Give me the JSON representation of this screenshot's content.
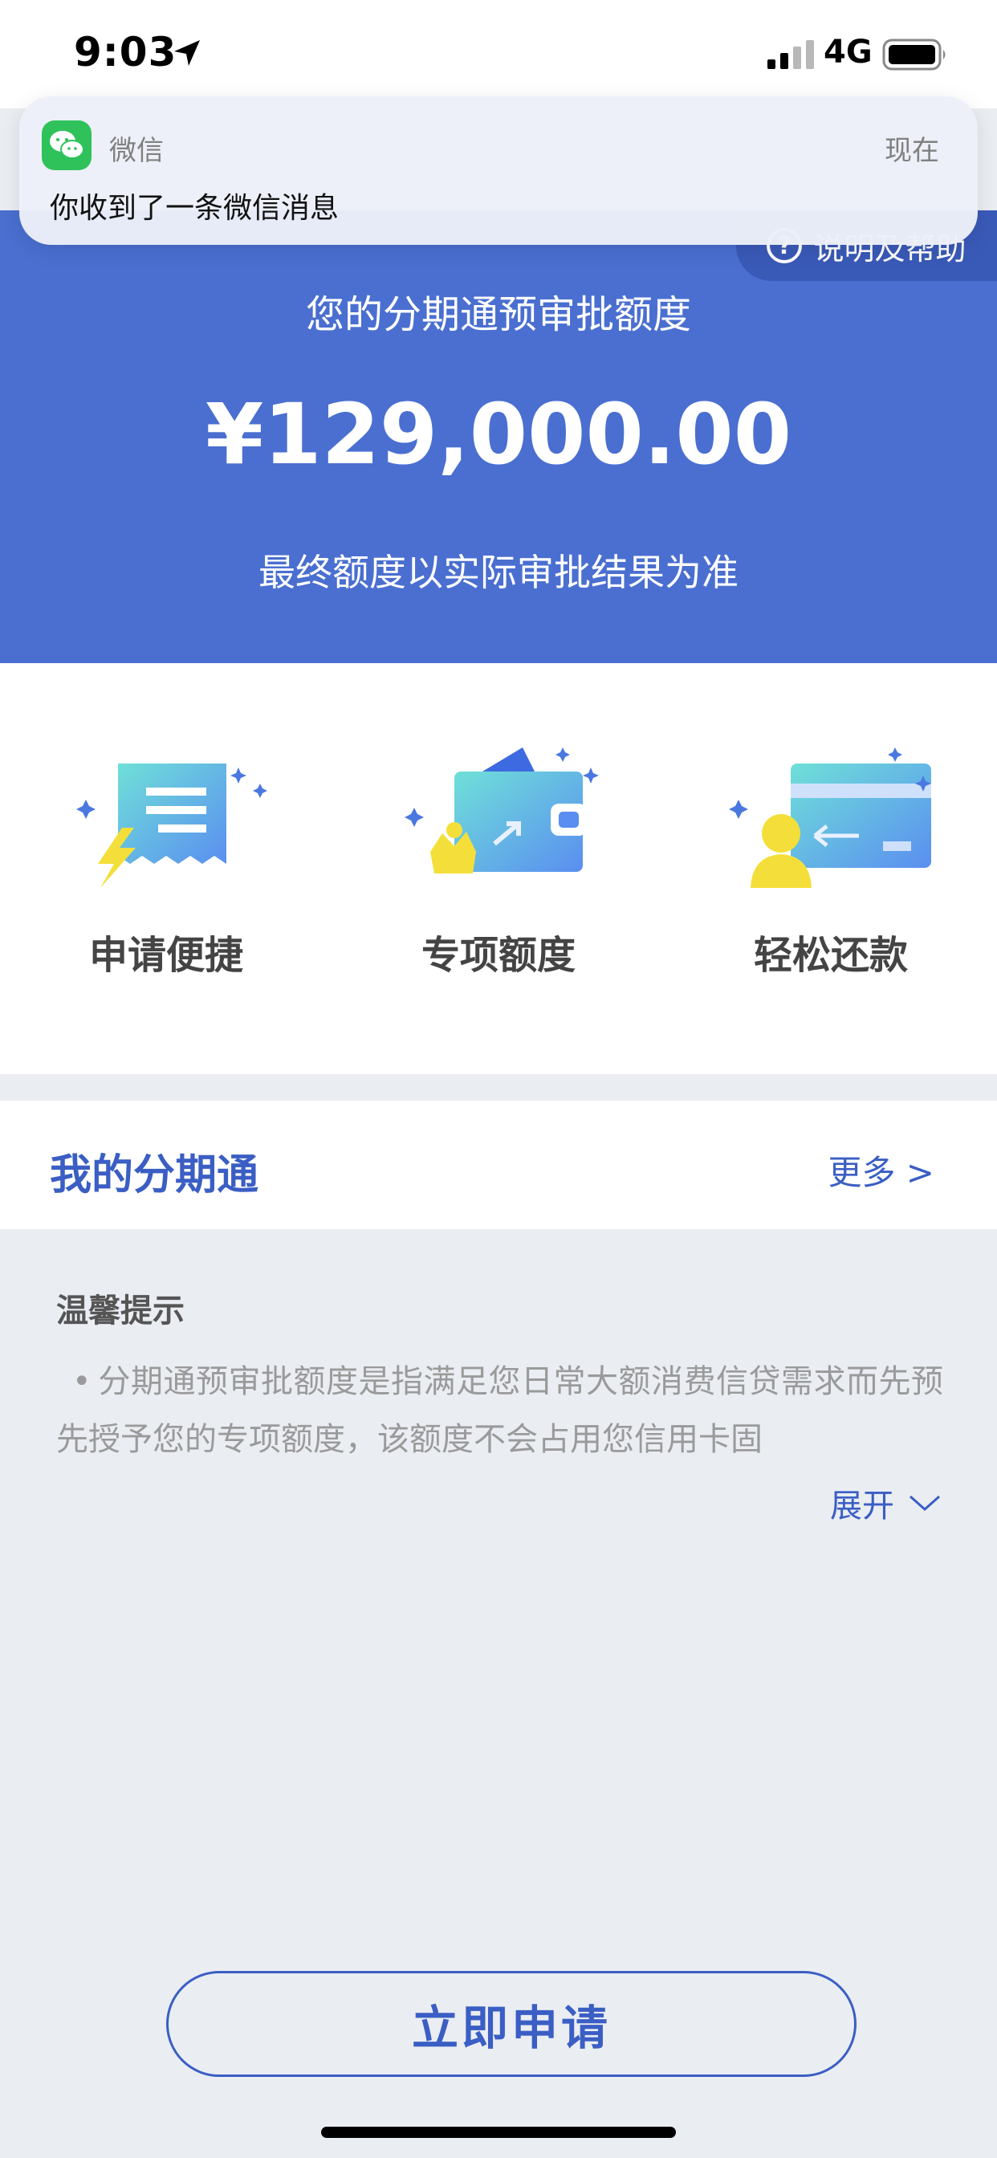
{
  "status_bar": {
    "time": "9:03",
    "network": "4G",
    "icons": [
      "location-arrow-icon",
      "signal-icon",
      "battery-icon"
    ]
  },
  "notification": {
    "app_name": "微信",
    "time": "现在",
    "message": "你收到了一条微信消息",
    "icon": "wechat-icon"
  },
  "banner": {
    "help_label": "说明及帮助",
    "title": "您的分期通预审批额度",
    "amount": "¥129,000.00",
    "note": "最终额度以实际审批结果为准",
    "color": "#4a6fd0"
  },
  "features": [
    {
      "label": "申请便捷",
      "icon": "fast-apply-icon"
    },
    {
      "label": "专项额度",
      "icon": "wallet-crown-icon"
    },
    {
      "label": "轻松还款",
      "icon": "card-repay-icon"
    }
  ],
  "my_installment": {
    "title": "我的分期通",
    "more_label": "更多 >"
  },
  "tips": {
    "title": "温馨提示",
    "bullet": "•",
    "body": "分期通预审批额度是指满足您日常大额消费信贷需求而先预先授予您的专项额度，该额度不会占用您信用卡固",
    "expand_label": "展开"
  },
  "apply_button": {
    "label": "立即申请",
    "accent_color": "#3a5ec4"
  }
}
